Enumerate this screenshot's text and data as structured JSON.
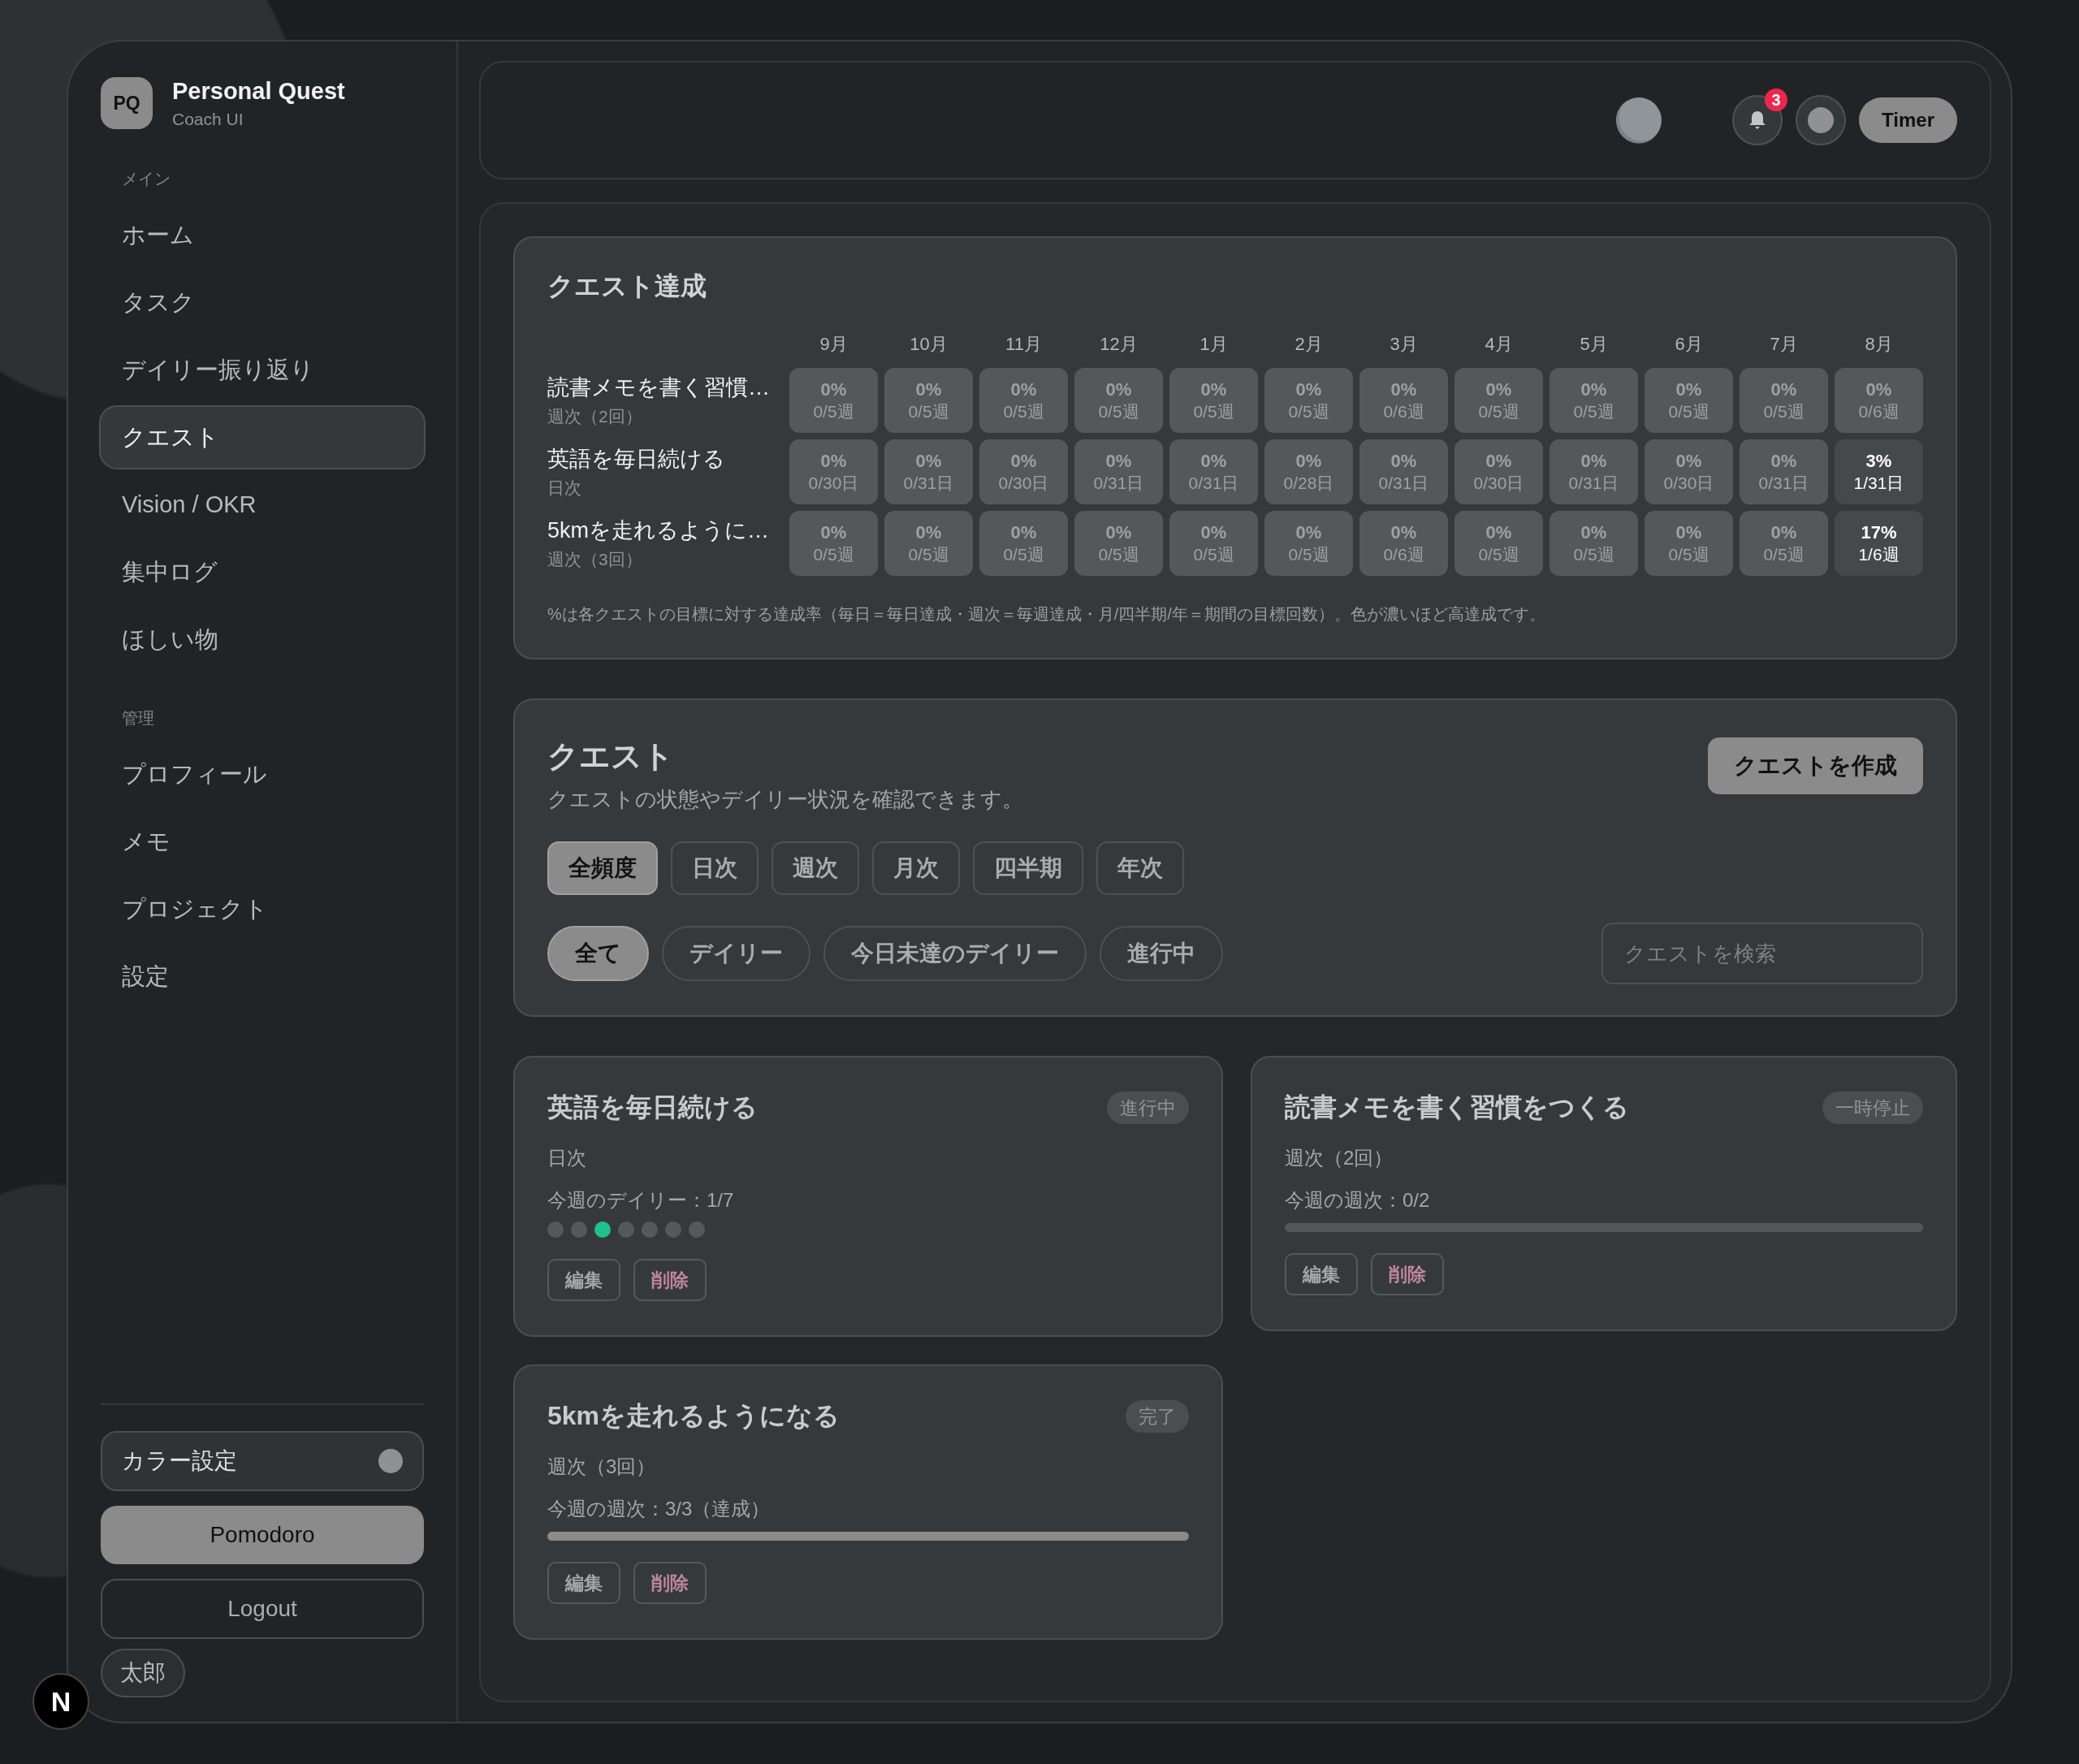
{
  "sidebar": {
    "logo": "PQ",
    "app_name": "Personal Quest",
    "app_subtitle": "Coach UI",
    "sections": [
      {
        "heading": "メイン",
        "items": [
          {
            "label": "ホーム",
            "selected": false
          },
          {
            "label": "タスク",
            "selected": false
          },
          {
            "label": "デイリー振り返り",
            "selected": false
          },
          {
            "label": "クエスト",
            "selected": true
          },
          {
            "label": "Vision / OKR",
            "selected": false
          },
          {
            "label": "集中ログ",
            "selected": false
          },
          {
            "label": "ほしい物",
            "selected": false
          }
        ]
      },
      {
        "heading": "管理",
        "items": [
          {
            "label": "プロフィール",
            "selected": false
          },
          {
            "label": "メモ",
            "selected": false
          },
          {
            "label": "プロジェクト",
            "selected": false
          },
          {
            "label": "設定",
            "selected": false
          }
        ]
      }
    ],
    "color_setting": "カラー設定",
    "pomodoro": "Pomodoro",
    "logout": "Logout",
    "user": "太郎"
  },
  "header": {
    "notification_count": "3",
    "timer": "Timer"
  },
  "heatmap": {
    "title": "クエスト達成",
    "months": [
      "9月",
      "10月",
      "11月",
      "12月",
      "1月",
      "2月",
      "3月",
      "4月",
      "5月",
      "6月",
      "7月",
      "8月"
    ],
    "rows": [
      {
        "name": "読書メモを書く習慣…",
        "frequency": "週次（2回）",
        "cells": [
          {
            "percent": "0%",
            "count": "0/5週",
            "highlighted": false
          },
          {
            "percent": "0%",
            "count": "0/5週",
            "highlighted": false
          },
          {
            "percent": "0%",
            "count": "0/5週",
            "highlighted": false
          },
          {
            "percent": "0%",
            "count": "0/5週",
            "highlighted": false
          },
          {
            "percent": "0%",
            "count": "0/5週",
            "highlighted": false
          },
          {
            "percent": "0%",
            "count": "0/5週",
            "highlighted": false
          },
          {
            "percent": "0%",
            "count": "0/6週",
            "highlighted": false
          },
          {
            "percent": "0%",
            "count": "0/5週",
            "highlighted": false
          },
          {
            "percent": "0%",
            "count": "0/5週",
            "highlighted": false
          },
          {
            "percent": "0%",
            "count": "0/5週",
            "highlighted": false
          },
          {
            "percent": "0%",
            "count": "0/5週",
            "highlighted": false
          },
          {
            "percent": "0%",
            "count": "0/6週",
            "highlighted": false
          }
        ]
      },
      {
        "name": "英語を毎日続ける",
        "frequency": "日次",
        "cells": [
          {
            "percent": "0%",
            "count": "0/30日",
            "highlighted": false
          },
          {
            "percent": "0%",
            "count": "0/31日",
            "highlighted": false
          },
          {
            "percent": "0%",
            "count": "0/30日",
            "highlighted": false
          },
          {
            "percent": "0%",
            "count": "0/31日",
            "highlighted": false
          },
          {
            "percent": "0%",
            "count": "0/31日",
            "highlighted": false
          },
          {
            "percent": "0%",
            "count": "0/28日",
            "highlighted": false
          },
          {
            "percent": "0%",
            "count": "0/31日",
            "highlighted": false
          },
          {
            "percent": "0%",
            "count": "0/30日",
            "highlighted": false
          },
          {
            "percent": "0%",
            "count": "0/31日",
            "highlighted": false
          },
          {
            "percent": "0%",
            "count": "0/30日",
            "highlighted": false
          },
          {
            "percent": "0%",
            "count": "0/31日",
            "highlighted": false
          },
          {
            "percent": "3%",
            "count": "1/31日",
            "highlighted": true
          }
        ]
      },
      {
        "name": "5kmを走れるように…",
        "frequency": "週次（3回）",
        "cells": [
          {
            "percent": "0%",
            "count": "0/5週",
            "highlighted": false
          },
          {
            "percent": "0%",
            "count": "0/5週",
            "highlighted": false
          },
          {
            "percent": "0%",
            "count": "0/5週",
            "highlighted": false
          },
          {
            "percent": "0%",
            "count": "0/5週",
            "highlighted": false
          },
          {
            "percent": "0%",
            "count": "0/5週",
            "highlighted": false
          },
          {
            "percent": "0%",
            "count": "0/5週",
            "highlighted": false
          },
          {
            "percent": "0%",
            "count": "0/6週",
            "highlighted": false
          },
          {
            "percent": "0%",
            "count": "0/5週",
            "highlighted": false
          },
          {
            "percent": "0%",
            "count": "0/5週",
            "highlighted": false
          },
          {
            "percent": "0%",
            "count": "0/5週",
            "highlighted": false
          },
          {
            "percent": "0%",
            "count": "0/5週",
            "highlighted": false
          },
          {
            "percent": "17%",
            "count": "1/6週",
            "highlighted": true
          }
        ]
      }
    ],
    "note": "%は各クエストの目標に対する達成率（毎日＝毎日達成・週次＝毎週達成・月/四半期/年＝期間の目標回数）。色が濃いほど高達成です。"
  },
  "quests_panel": {
    "title": "クエスト",
    "subtitle": "クエストの状態やデイリー状況を確認できます。",
    "create_button": "クエストを作成",
    "frequency_filters": [
      {
        "label": "全頻度",
        "selected": true
      },
      {
        "label": "日次",
        "selected": false
      },
      {
        "label": "週次",
        "selected": false
      },
      {
        "label": "月次",
        "selected": false
      },
      {
        "label": "四半期",
        "selected": false
      },
      {
        "label": "年次",
        "selected": false
      }
    ],
    "status_filters": [
      {
        "label": "全て",
        "selected": true
      },
      {
        "label": "デイリー",
        "selected": false
      },
      {
        "label": "今日未達のデイリー",
        "selected": false
      },
      {
        "label": "進行中",
        "selected": false
      }
    ],
    "search_placeholder": "クエストを検索"
  },
  "quest_cards": [
    {
      "kind": "daily",
      "title": "英語を毎日続ける",
      "status": "進行中",
      "frequency": "日次",
      "progress": "今週のデイリー：1/7",
      "days": [
        {
          "done": false
        },
        {
          "done": false
        },
        {
          "done": true
        },
        {
          "done": false
        },
        {
          "done": false
        },
        {
          "done": false
        },
        {
          "done": false
        }
      ],
      "edit": "編集",
      "delete": "削除"
    },
    {
      "kind": "weekly",
      "title": "読書メモを書く習慣をつくる",
      "status": "一時停止",
      "frequency": "週次（2回）",
      "progress": "今週の週次：0/2",
      "level": 0,
      "edit": "編集",
      "delete": "削除"
    },
    {
      "kind": "weekly",
      "title": "5kmを走れるようになる",
      "status": "完了",
      "frequency": "週次（3回）",
      "progress": "今週の週次：3/3（達成）",
      "level": 1,
      "edit": "編集",
      "delete": "削除"
    }
  ],
  "dev_badge": "N"
}
